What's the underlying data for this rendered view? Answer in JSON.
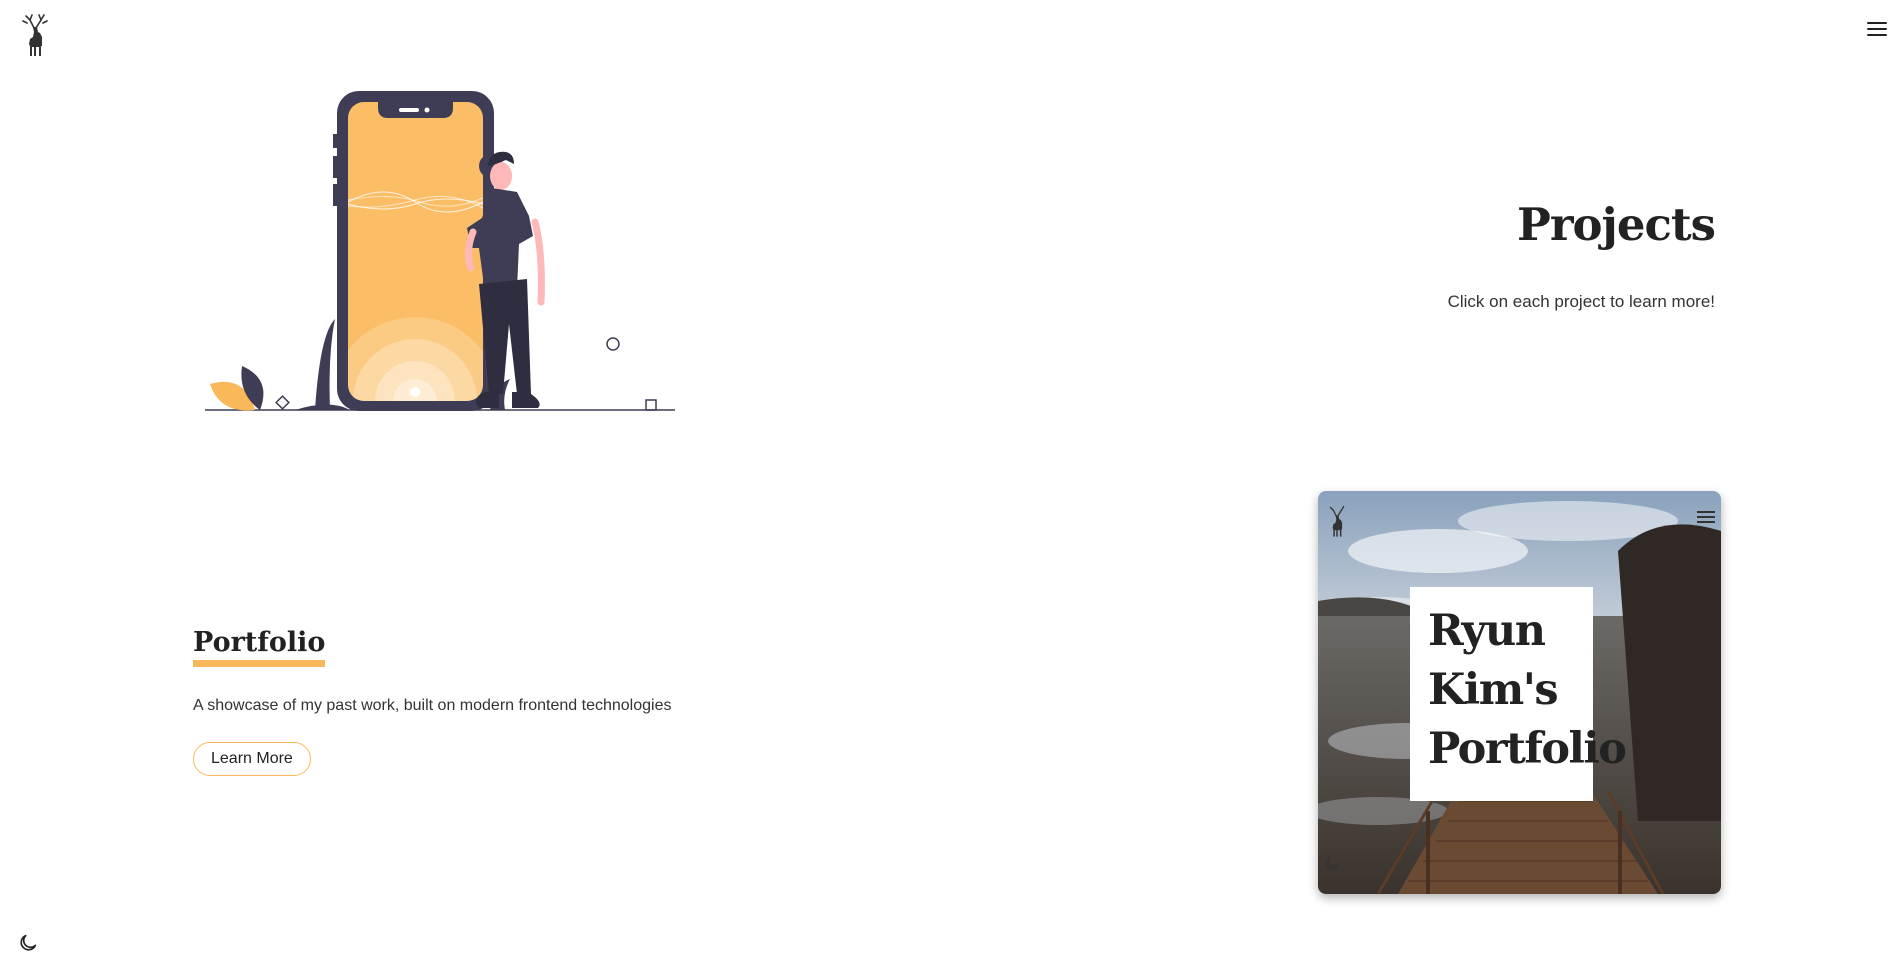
{
  "header": {
    "logo_icon": "deer-icon",
    "menu_icon": "hamburger-menu-icon"
  },
  "hero": {
    "title": "Projects",
    "subtitle": "Click on each project to learn more!",
    "illustration": "person-leaning-on-phone-illustration"
  },
  "projects": [
    {
      "title": "Portfolio",
      "description": "A showcase of my past work, built on modern frontend technologies",
      "button_label": "Learn More",
      "preview": {
        "title": "Ryun Kim's Portfolio",
        "background": "lake-dock-photo"
      }
    }
  ],
  "footer": {
    "theme_toggle_icon": "moon-icon"
  },
  "colors": {
    "accent": "#f9b95a",
    "dark": "#3f3d56",
    "text": "#333333"
  }
}
